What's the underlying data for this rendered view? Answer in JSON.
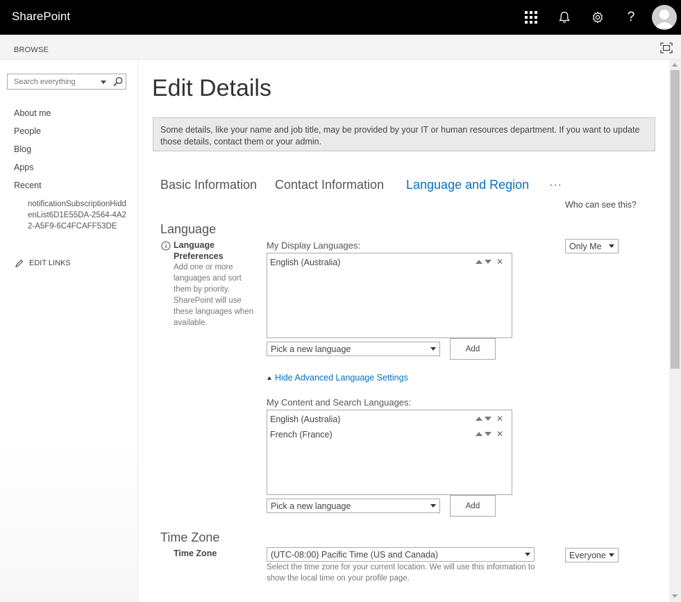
{
  "suitebar": {
    "brand": "SharePoint",
    "icons": [
      "app-launcher-icon",
      "bell-icon",
      "gear-icon",
      "help-icon",
      "avatar"
    ]
  },
  "ribbon": {
    "browse_label": "BROWSE"
  },
  "leftnav": {
    "search_placeholder": "Search everything",
    "items": [
      "About me",
      "People",
      "Blog",
      "Apps",
      "Recent"
    ],
    "recent_item": "notificationSubscriptionHiddenList6D1E55DA-2564-4A22-A5F9-6C4FCAFF53DE",
    "edit_links": "EDIT LINKS"
  },
  "main": {
    "title": "Edit Details",
    "notice": "Some details, like your name and job title, may be provided by your IT or human resources department. If you want to update those details, contact them or your admin.",
    "tabs": [
      {
        "label": "Basic Information",
        "active": false
      },
      {
        "label": "Contact Information",
        "active": false
      },
      {
        "label": "Language and Region",
        "active": true
      }
    ],
    "more_label": "···",
    "who_can_see": "Who can see this?",
    "language": {
      "section_title": "Language",
      "field_label_1": "Language",
      "field_label_2": "Preferences",
      "help": "Add one or more languages and sort them by priority. SharePoint will use these languages when available.",
      "visibility": "Only Me",
      "display_label": "My Display Languages:",
      "display_languages": [
        "English (Australia)"
      ],
      "picker_placeholder": "Pick a new language",
      "add_label": "Add",
      "advanced_link": "Hide Advanced Language Settings",
      "content_label": "My Content and Search Languages:",
      "content_languages": [
        "English (Australia)",
        "French (France)"
      ],
      "picker2_placeholder": "Pick a new language",
      "add2_label": "Add"
    },
    "timezone": {
      "section_title": "Time Zone",
      "field_label": "Time Zone",
      "value": "(UTC-08:00) Pacific Time (US and Canada)",
      "visibility": "Everyone",
      "help": "Select the time zone for your current location. We will use this information to show the local time on your profile page."
    }
  },
  "colors": {
    "accent": "#0072c6",
    "suitebar": "#000000"
  }
}
